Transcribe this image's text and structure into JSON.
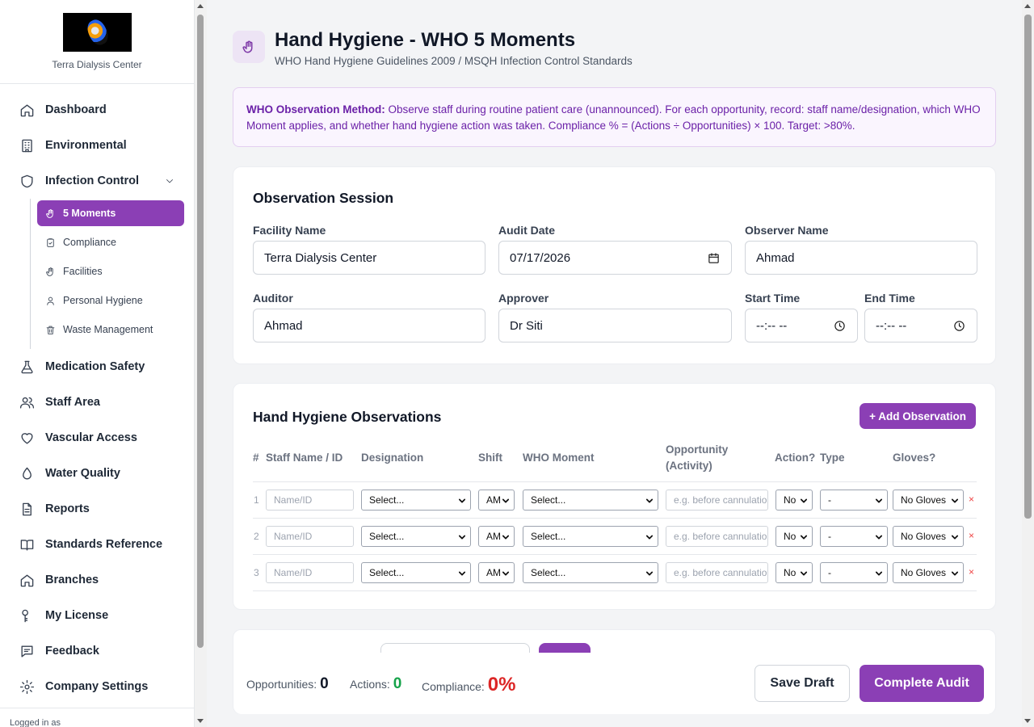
{
  "brand": {
    "name": "Terra Dialysis Center"
  },
  "sidebar": {
    "items": [
      {
        "label": "Dashboard",
        "icon": "home-icon"
      },
      {
        "label": "Environmental",
        "icon": "building-icon"
      },
      {
        "label": "Infection Control",
        "icon": "shield-icon"
      },
      {
        "label": "Medication Safety",
        "icon": "flask-icon"
      },
      {
        "label": "Staff Area",
        "icon": "users-icon"
      },
      {
        "label": "Vascular Access",
        "icon": "heart-icon"
      },
      {
        "label": "Water Quality",
        "icon": "droplet-icon"
      },
      {
        "label": "Reports",
        "icon": "file-icon"
      },
      {
        "label": "Standards Reference",
        "icon": "book-icon"
      },
      {
        "label": "Branches",
        "icon": "home-icon"
      },
      {
        "label": "My License",
        "icon": "key-icon"
      },
      {
        "label": "Feedback",
        "icon": "message-icon"
      },
      {
        "label": "Company Settings",
        "icon": "gear-icon"
      }
    ],
    "subitems": [
      {
        "label": "5 Moments",
        "icon": "hand-icon",
        "active": true
      },
      {
        "label": "Compliance",
        "icon": "clipboard-check-icon"
      },
      {
        "label": "Facilities",
        "icon": "hand-icon"
      },
      {
        "label": "Personal Hygiene",
        "icon": "user-icon"
      },
      {
        "label": "Waste Management",
        "icon": "trash-icon"
      }
    ],
    "logged_in": "Logged in as"
  },
  "header": {
    "title": "Hand Hygiene - WHO 5 Moments",
    "subtitle": "WHO Hand Hygiene Guidelines 2009 / MSQH Infection Control Standards"
  },
  "info": {
    "label": "WHO Observation Method:",
    "text": " Observe staff during routine patient care (unannounced). For each opportunity, record: staff name/designation, which WHO Moment applies, and whether hand hygiene action was taken. Compliance % = (Actions ÷ Opportunities) × 100. Target: >80%."
  },
  "session": {
    "title": "Observation Session",
    "facility_label": "Facility Name",
    "facility_value": "Terra Dialysis Center",
    "date_label": "Audit Date",
    "date_value": "07/17/2026",
    "observer_label": "Observer Name",
    "observer_value": "Ahmad",
    "auditor_label": "Auditor",
    "auditor_value": "Ahmad",
    "approver_label": "Approver",
    "approver_value": "Dr Siti",
    "start_label": "Start Time",
    "start_value": "--:-- --",
    "end_label": "End Time",
    "end_value": "--:-- --"
  },
  "observations": {
    "title": "Hand Hygiene Observations",
    "add_label": "+ Add Observation",
    "headers": {
      "num": "#",
      "staff": "Staff Name / ID",
      "designation": "Designation",
      "shift": "Shift",
      "moment": "WHO Moment",
      "opportunity_1": "Opportunity",
      "opportunity_2": "(Activity)",
      "action": "Action?",
      "type": "Type",
      "gloves": "Gloves?"
    },
    "rows": [
      {
        "num": "1",
        "staff_ph": "Name/ID",
        "designation": "Select...",
        "shift": "AM",
        "moment": "Select...",
        "activity_ph": "e.g. before cannulation",
        "action": "No",
        "type": "-",
        "gloves": "No Gloves",
        "delete": "×"
      },
      {
        "num": "2",
        "staff_ph": "Name/ID",
        "designation": "Select...",
        "shift": "AM",
        "moment": "Select...",
        "activity_ph": "e.g. before cannulation",
        "action": "No",
        "type": "-",
        "gloves": "No Gloves",
        "delete": "×"
      },
      {
        "num": "3",
        "staff_ph": "Name/ID",
        "designation": "Select...",
        "shift": "AM",
        "moment": "Select...",
        "activity_ph": "e.g. before cannulation",
        "action": "No",
        "type": "-",
        "gloves": "No Gloves",
        "delete": "×"
      }
    ]
  },
  "summary": {
    "opportunities_label": "Opportunities:",
    "opportunities_value": "0",
    "actions_label": "Actions:",
    "actions_value": "0",
    "compliance_label": "Compliance:",
    "compliance_value": "0%",
    "save_label": "Save Draft",
    "complete_label": "Complete Audit"
  },
  "colors": {
    "accent": "#8b3fb5",
    "success": "#16a34a",
    "danger": "#dc2626"
  }
}
